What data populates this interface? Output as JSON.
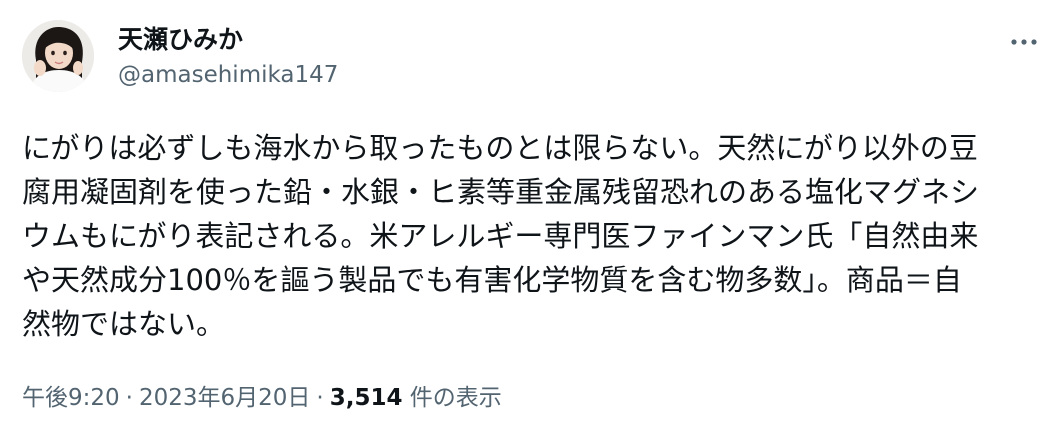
{
  "author": {
    "display_name": "天瀬ひみか",
    "handle": "@amasehimika147"
  },
  "tweet": {
    "text": "にがりは必ずしも海水から取ったものとは限らない。天然にがり以外の豆\n腐用凝固剤を使った鉛・水銀・ヒ素等重金属残留恐れのある塩化マグネシ\nウムもにがり表記される。米アレルギー専門医ファインマン氏「自然由来\nや天然成分100％を謳う製品でも有害化学物質を含む物多数」。商品＝自\n然物ではない。"
  },
  "meta": {
    "time": "午後9:20",
    "separator": "·",
    "date": "2023年6月20日",
    "views_count": "3,514",
    "views_label": "件の表示"
  },
  "icons": {
    "more": "more-horizontal-icon",
    "avatar": "profile-photo"
  },
  "colors": {
    "primary_text": "#0f1419",
    "secondary_text": "#536471",
    "background": "#ffffff"
  }
}
